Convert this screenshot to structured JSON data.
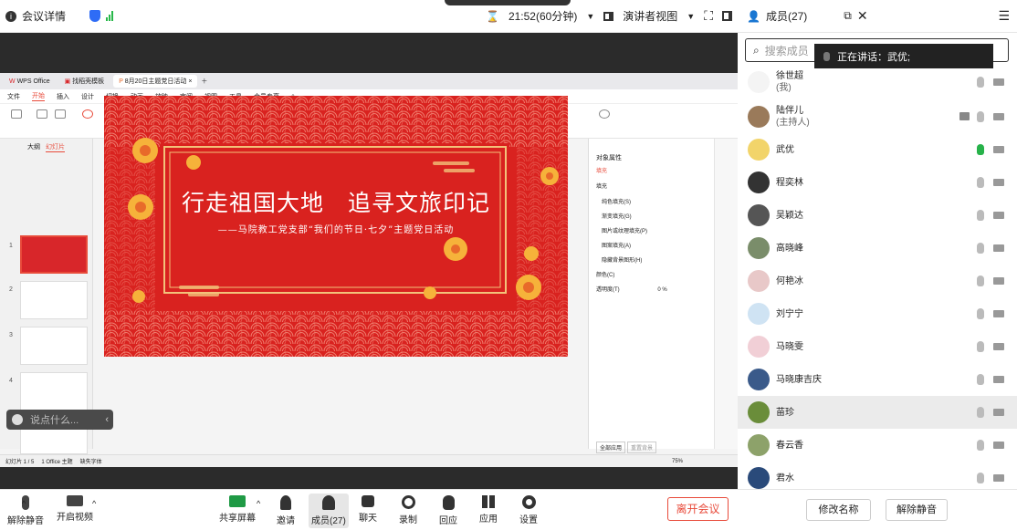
{
  "topbar": {
    "meeting_info": "会议详情",
    "timer": "21:52(60分钟)",
    "view_mode": "演讲者视图"
  },
  "right_panel": {
    "title": "成员(27)",
    "search_placeholder": "搜索成员",
    "speaking_label": "正在讲话：武优;",
    "members": [
      {
        "name": "徐世超",
        "role": "(我)",
        "color": "#f4f4f4",
        "mic": "off"
      },
      {
        "name": "陆伴儿",
        "role": "(主持人)",
        "color": "#9a7a5a",
        "mic": "off",
        "screen": true
      },
      {
        "name": "武优",
        "role": "",
        "color": "#f2d46a",
        "mic": "on"
      },
      {
        "name": "程奕林",
        "role": "",
        "color": "#333333",
        "mic": "off"
      },
      {
        "name": "吴颖达",
        "role": "",
        "color": "#555555",
        "mic": "off"
      },
      {
        "name": "高晓峰",
        "role": "",
        "color": "#7a8d6a",
        "mic": "off"
      },
      {
        "name": "何艳冰",
        "role": "",
        "color": "#e8c8c8",
        "mic": "off"
      },
      {
        "name": "刘宁宁",
        "role": "",
        "color": "#cfe3f3",
        "mic": "off"
      },
      {
        "name": "马晓雯",
        "role": "",
        "color": "#f1cfd6",
        "mic": "off"
      },
      {
        "name": "马晓康吉庆",
        "role": "",
        "color": "#3a5a8a",
        "mic": "off"
      },
      {
        "name": "苗珍",
        "role": "",
        "color": "#6a8d3a",
        "mic": "off"
      },
      {
        "name": "春云香",
        "role": "",
        "color": "#8da26a",
        "mic": "off"
      },
      {
        "name": "君水",
        "role": "",
        "color": "#2a4a7a",
        "mic": "off"
      }
    ],
    "rename_btn": "修改名称",
    "unmute_btn": "解除静音"
  },
  "wps": {
    "tab_office": "WPS Office",
    "tab_find": "找稻壳模板",
    "tab_doc": "8月20日主题党日活动",
    "menus": [
      "文件",
      "开始",
      "插入",
      "设计",
      "切换",
      "动画",
      "放映",
      "审阅",
      "视图",
      "工具",
      "会员专享"
    ],
    "tabs_outline": "大纲",
    "tabs_slides": "幻灯片",
    "props_title": "对象属性",
    "props_fill": "填充",
    "props_options": [
      "纯色填充(S)",
      "渐变填充(G)",
      "图片或纹理填充(P)",
      "图案填充(A)",
      "隐藏背景图形(H)"
    ],
    "props_color": "颜色(C)",
    "props_transparency": "透明度(T)",
    "props_transparency_val": "0",
    "props_pct": "%",
    "props_apply_all": "全部应用",
    "props_reset": "重置背景",
    "status_page": "幻灯片 1 / 5",
    "status_theme": "1 Office 主题",
    "status_font": "缺失字体",
    "status_zoom": "75%"
  },
  "slide": {
    "title": "行走祖国大地　追寻文旅印记",
    "subtitle": "——马院教工党支部“我们的节日·七夕”主题党日活动"
  },
  "chat": {
    "placeholder": "说点什么..."
  },
  "bottom": {
    "mute": "解除静音",
    "video": "开启视频",
    "share": "共享屏幕",
    "invite": "邀请",
    "members": "成员(27)",
    "chat": "聊天",
    "record": "录制",
    "interact": "回应",
    "apps": "应用",
    "settings": "设置",
    "leave": "离开会议"
  }
}
